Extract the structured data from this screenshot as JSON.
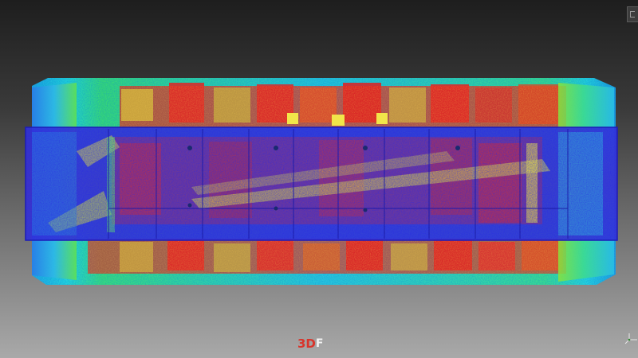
{
  "viewer": {
    "logo_red_text": "3D",
    "logo_white_text": "F",
    "colors": {
      "background_top": "#1e1e1e",
      "background_bottom": "#a9a9a9",
      "cloud_low": "#2a3bd6",
      "cloud_mid": "#20d0e8",
      "cloud_high": "#e3e23a",
      "cloud_peak": "#e51f1f",
      "logo_red": "#d9342b"
    },
    "icons": [
      "restore-view-icon",
      "axis-trihedron-icon"
    ]
  }
}
